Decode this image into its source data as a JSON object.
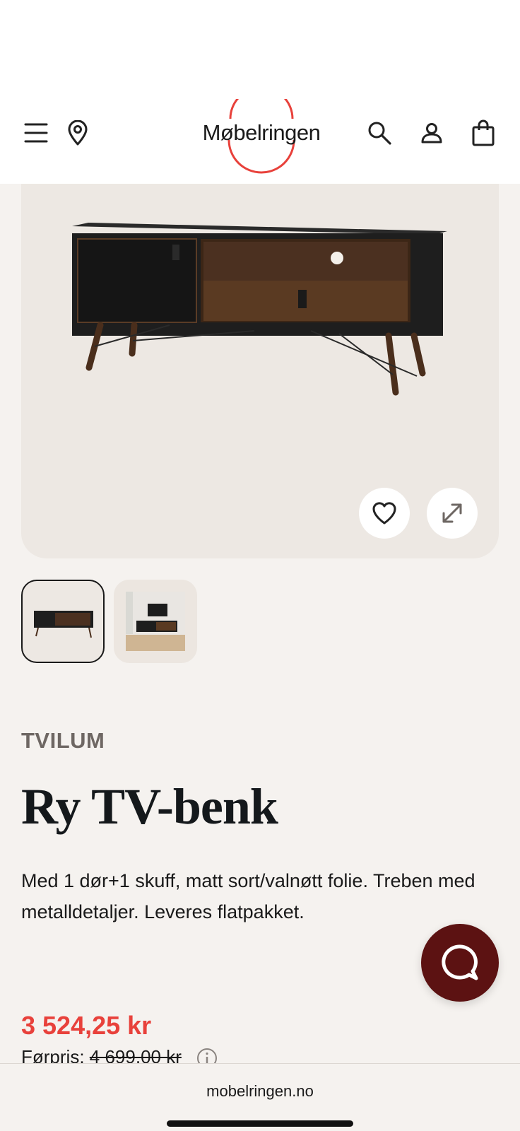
{
  "header": {
    "logo_text": "Møbelringen",
    "icons": [
      "menu-icon",
      "location-pin-icon",
      "search-icon",
      "user-icon",
      "shopping-bag-icon"
    ]
  },
  "gallery": {
    "image_alt": "Ry TV-benk",
    "favorite_icon": "heart-icon",
    "expand_icon": "expand-icon",
    "thumbnails": 2
  },
  "product": {
    "brand": "TVILUM",
    "title": "Ry TV-benk",
    "description": "Med 1 dør+1 skuff, matt sort/valnøtt folie. Treben med metalldetaljer. Leveres flatpakket.",
    "price": "3 524,25 kr",
    "previous_price_label": "Førpris:",
    "previous_price_value": "4 699,00 kr"
  },
  "chat": {
    "icon": "chat-icon"
  },
  "browser": {
    "url": "mobelringen.no"
  },
  "colors": {
    "background": "#f5f2ef",
    "price_red": "#e8413b",
    "logo_ring": "#e8413b",
    "chat_button": "#5c1212",
    "brand_gray": "#6e6763"
  }
}
